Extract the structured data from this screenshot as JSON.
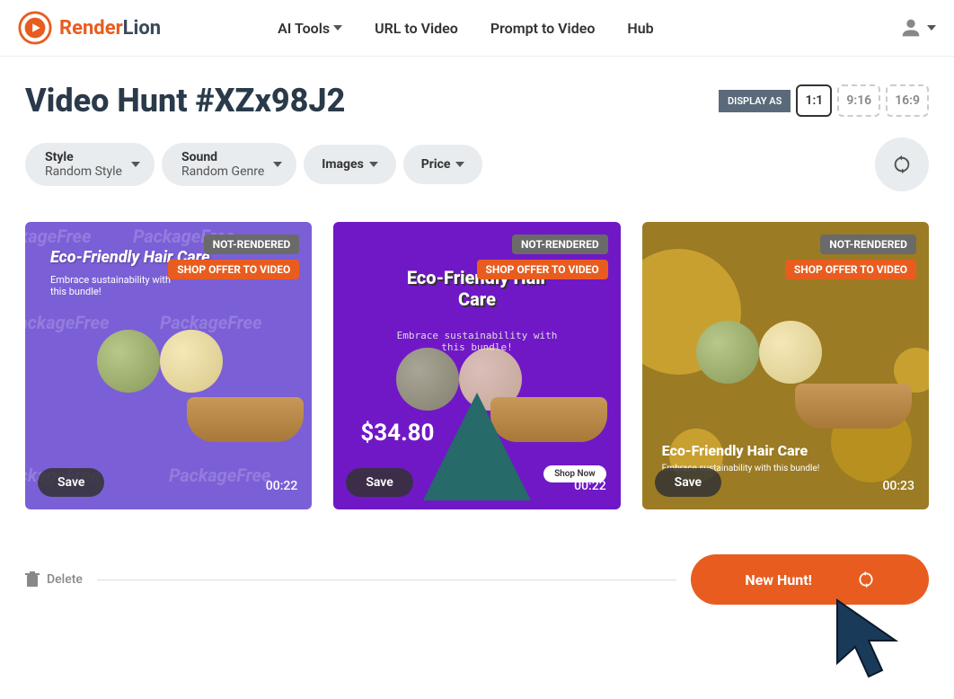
{
  "brand": {
    "render": "Render",
    "lion": "Lion"
  },
  "nav": {
    "ai_tools": "AI Tools",
    "url_to_video": "URL to Video",
    "prompt_to_video": "Prompt to Video",
    "hub": "Hub"
  },
  "page_title": "Video Hunt #XZx98J2",
  "display": {
    "label": "DISPLAY AS",
    "aspects": {
      "r11": "1:1",
      "r916": "9:16",
      "r169": "16:9"
    }
  },
  "filters": {
    "style_label": "Style",
    "style_value": "Random Style",
    "sound_label": "Sound",
    "sound_value": "Random Genre",
    "images": "Images",
    "price": "Price"
  },
  "badges": {
    "not_rendered": "NOT-RENDERED",
    "shop_offer": "SHOP OFFER TO VIDEO"
  },
  "cards": [
    {
      "title": "Eco‑Friendly Hair Care",
      "subtitle": "Embrace sustainability with this bundle!",
      "pattern_text": "PackageFree",
      "duration": "00:22",
      "save": "Save"
    },
    {
      "title": "Eco‑Friendly Hair Care",
      "subtitle": "Embrace sustainability with this bundle!",
      "price": "$34.80",
      "shop_now": "Shop Now",
      "duration": "00:22",
      "save": "Save"
    },
    {
      "title": "Eco-Friendly Hair Care",
      "subtitle": "Embrace sustainability with this bundle!",
      "duration": "00:23",
      "save": "Save"
    }
  ],
  "bottom": {
    "delete": "Delete",
    "new_hunt": "New Hunt!"
  }
}
